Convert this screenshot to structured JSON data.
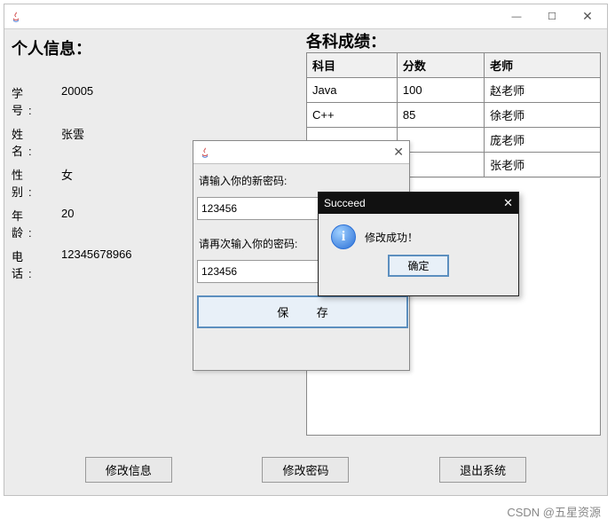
{
  "window": {
    "min": "—",
    "max": "☐",
    "close": "✕"
  },
  "personal": {
    "title": "个人信息：",
    "rows": {
      "id_label": "学 号:",
      "id_value": "20005",
      "name_label": "姓 名:",
      "name_value": "张雲",
      "gender_label": "性 别:",
      "gender_value": "女",
      "age_label": "年 龄:",
      "age_value": "20",
      "phone_label": "电 话:",
      "phone_value": "12345678966"
    }
  },
  "grades": {
    "title": "各科成绩：",
    "headers": {
      "subject": "科目",
      "score": "分数",
      "teacher": "老师"
    },
    "rows": [
      {
        "subject": "Java",
        "score": "100",
        "teacher": "赵老师"
      },
      {
        "subject": "C++",
        "score": "85",
        "teacher": "徐老师"
      },
      {
        "subject": "",
        "score": "",
        "teacher": "庞老师"
      },
      {
        "subject": "",
        "score": "",
        "teacher": "张老师"
      }
    ]
  },
  "buttons": {
    "edit_info": "修改信息",
    "edit_pwd": "修改密码",
    "exit": "退出系统"
  },
  "pwd_dialog": {
    "label1": "请输入你的新密码:",
    "value1": "123456",
    "label2": "请再次输入你的密码:",
    "value2": "123456",
    "save": "保  存",
    "close": "✕"
  },
  "succeed_dialog": {
    "title": "Succeed",
    "message": "修改成功！",
    "ok": "确定",
    "close": "✕"
  },
  "watermark": "CSDN @五星资源"
}
